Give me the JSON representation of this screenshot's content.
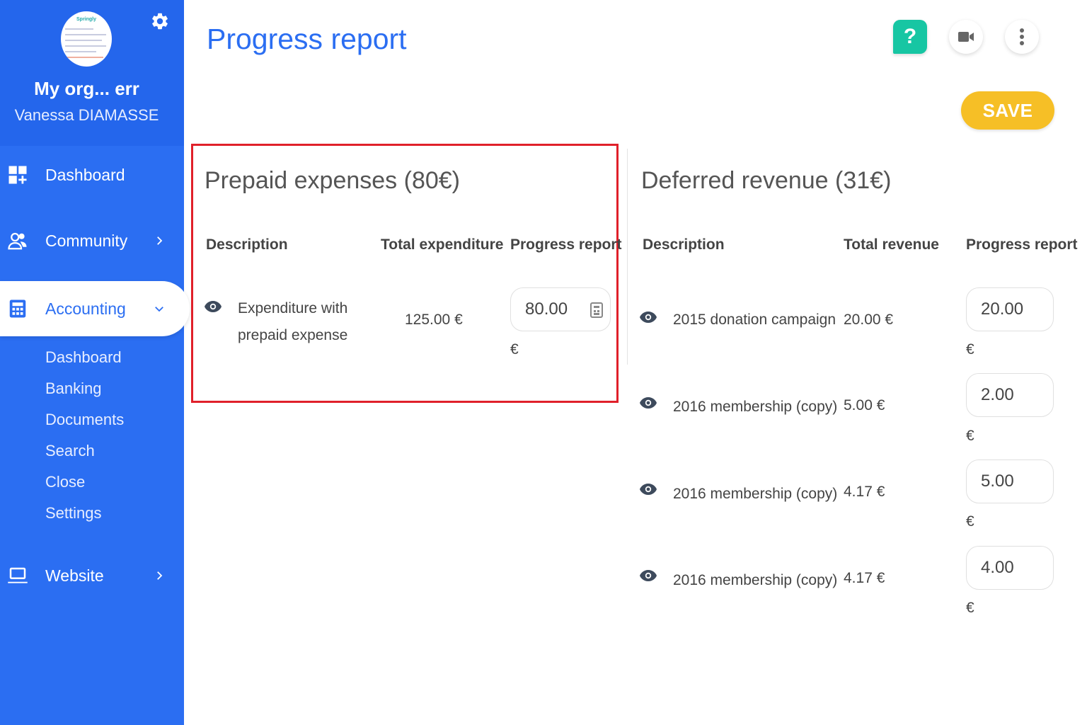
{
  "sidebar": {
    "org_name": "My org... err",
    "user_name": "Vanessa DIAMASSE",
    "logo_text": "Springly",
    "nav": [
      {
        "label": "Dashboard",
        "icon": "dashboard-icon"
      },
      {
        "label": "Community",
        "icon": "community-icon"
      },
      {
        "label": "Accounting",
        "icon": "calculator-icon",
        "active": true
      },
      {
        "label": "Website",
        "icon": "laptop-icon"
      }
    ],
    "accounting_sub": [
      "Dashboard",
      "Banking",
      "Documents",
      "Search",
      "Close",
      "Settings"
    ]
  },
  "page": {
    "title": "Progress report",
    "save_label": "SAVE",
    "help_label": "?"
  },
  "prepaid": {
    "title": "Prepaid expenses (80€)",
    "headers": [
      "Description",
      "Total expenditure",
      "Progress report"
    ],
    "rows": [
      {
        "description_line1": "Expenditure with",
        "description_line2": "prepaid expense",
        "total": "125.00 €",
        "progress": "80.00",
        "currency": "€"
      }
    ]
  },
  "deferred": {
    "title": "Deferred revenue (31€)",
    "headers": [
      "Description",
      "Total revenue",
      "Progress report"
    ],
    "rows": [
      {
        "description": "2015 donation campaign",
        "total": "20.00 €",
        "progress": "20.00",
        "currency": "€"
      },
      {
        "description": "2016 membership (copy)",
        "total": "5.00 €",
        "progress": "2.00",
        "currency": "€"
      },
      {
        "description": "2016 membership (copy)",
        "total": "4.17 €",
        "progress": "5.00",
        "currency": "€"
      },
      {
        "description": "2016 membership (copy)",
        "total": "4.17 €",
        "progress": "4.00",
        "currency": "€"
      }
    ]
  },
  "colors": {
    "primary": "#2b6ef2",
    "save": "#f6bf26",
    "help": "#17c6a3",
    "highlight": "#e0202a"
  }
}
